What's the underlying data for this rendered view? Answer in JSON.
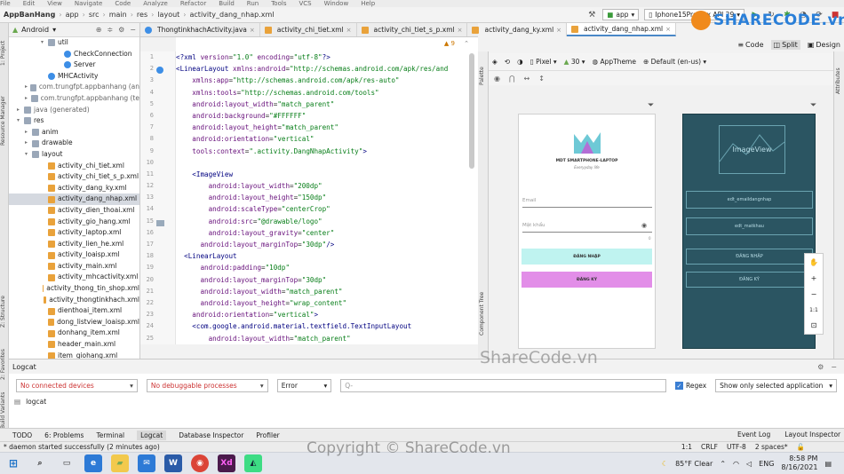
{
  "menu": [
    "File",
    "Edit",
    "View",
    "Navigate",
    "Code",
    "Analyze",
    "Refactor",
    "Build",
    "Run",
    "Tools",
    "VCS",
    "Window",
    "Help"
  ],
  "breadcrumbs": [
    "AppBanHang",
    "app",
    "src",
    "main",
    "res",
    "layout",
    "activity_dang_nhap.xml"
  ],
  "run_config": "app",
  "device": "Iphone15ProMax API 29",
  "project_view": "Android",
  "tree": [
    {
      "label": "util",
      "icon": "folder",
      "indent": 4,
      "arrow": "▾"
    },
    {
      "label": "CheckConnection",
      "icon": "class",
      "indent": 6,
      "arrow": ""
    },
    {
      "label": "Server",
      "icon": "class",
      "indent": 6,
      "arrow": ""
    },
    {
      "label": "MHCActivity",
      "icon": "class",
      "indent": 4,
      "arrow": ""
    },
    {
      "label": "com.trungfpt.appbanhang (an",
      "icon": "folder",
      "indent": 2,
      "arrow": "▸"
    },
    {
      "label": "com.trungfpt.appbanhang (te",
      "icon": "folder",
      "indent": 2,
      "arrow": "▸"
    },
    {
      "label": "java (generated)",
      "icon": "folder",
      "indent": 1,
      "arrow": "▸"
    },
    {
      "label": "res",
      "icon": "folder",
      "indent": 1,
      "arrow": "▾"
    },
    {
      "label": "anim",
      "icon": "folder",
      "indent": 2,
      "arrow": "▸"
    },
    {
      "label": "drawable",
      "icon": "folder",
      "indent": 2,
      "arrow": "▸"
    },
    {
      "label": "layout",
      "icon": "folder",
      "indent": 2,
      "arrow": "▾"
    },
    {
      "label": "activity_chi_tiet.xml",
      "icon": "xml",
      "indent": 4,
      "arrow": ""
    },
    {
      "label": "activity_chi_tiet_s_p.xml",
      "icon": "xml",
      "indent": 4,
      "arrow": ""
    },
    {
      "label": "activity_dang_ky.xml",
      "icon": "xml",
      "indent": 4,
      "arrow": ""
    },
    {
      "label": "activity_dang_nhap.xml",
      "icon": "xml",
      "indent": 4,
      "arrow": "",
      "selected": true
    },
    {
      "label": "activity_dien_thoai.xml",
      "icon": "xml",
      "indent": 4,
      "arrow": ""
    },
    {
      "label": "activity_gio_hang.xml",
      "icon": "xml",
      "indent": 4,
      "arrow": ""
    },
    {
      "label": "activity_laptop.xml",
      "icon": "xml",
      "indent": 4,
      "arrow": ""
    },
    {
      "label": "activity_lien_he.xml",
      "icon": "xml",
      "indent": 4,
      "arrow": ""
    },
    {
      "label": "activity_loaisp.xml",
      "icon": "xml",
      "indent": 4,
      "arrow": ""
    },
    {
      "label": "activity_main.xml",
      "icon": "xml",
      "indent": 4,
      "arrow": ""
    },
    {
      "label": "activity_mhcactivity.xml",
      "icon": "xml",
      "indent": 4,
      "arrow": ""
    },
    {
      "label": "activity_thong_tin_shop.xml",
      "icon": "xml",
      "indent": 4,
      "arrow": ""
    },
    {
      "label": "activity_thongtinkhach.xml",
      "icon": "xml",
      "indent": 4,
      "arrow": ""
    },
    {
      "label": "dienthoai_item.xml",
      "icon": "xml",
      "indent": 4,
      "arrow": ""
    },
    {
      "label": "dong_listview_loaisp.xml",
      "icon": "xml",
      "indent": 4,
      "arrow": ""
    },
    {
      "label": "donhang_item.xml",
      "icon": "xml",
      "indent": 4,
      "arrow": ""
    },
    {
      "label": "header_main.xml",
      "icon": "xml",
      "indent": 4,
      "arrow": ""
    },
    {
      "label": "item_giohang.xml",
      "icon": "xml",
      "indent": 4,
      "arrow": ""
    }
  ],
  "tabs": [
    {
      "label": "ThongtinkhachActivity.java",
      "active": false
    },
    {
      "label": "activity_chi_tiet.xml",
      "active": false
    },
    {
      "label": "activity_chi_tiet_s_p.xml",
      "active": false
    },
    {
      "label": "activity_dang_ky.xml",
      "active": false
    },
    {
      "label": "activity_dang_nhap.xml",
      "active": true
    }
  ],
  "line_numbers": [
    "1",
    "2",
    "3",
    "4",
    "5",
    "6",
    "7",
    "8",
    "9",
    "10",
    "11",
    "12",
    "13",
    "14",
    "15",
    "16",
    "17",
    "18",
    "19",
    "20",
    "21",
    "22",
    "23",
    "24",
    "25"
  ],
  "code_lines": [
    [
      [
        "tg",
        "<?xml "
      ],
      [
        "at",
        "version"
      ],
      [
        "",
        "="
      ],
      [
        "st",
        "\"1.0\""
      ],
      [
        "",
        ""
      ],
      [
        "at",
        " encoding"
      ],
      [
        "",
        "="
      ],
      [
        "st",
        "\"utf-8\""
      ],
      [
        "tg",
        "?>"
      ]
    ],
    [
      [
        "tg",
        "<LinearLayout "
      ],
      [
        "at",
        "xmlns:android"
      ],
      [
        "",
        "="
      ],
      [
        "st",
        "\"http://schemas.android.com/apk/res/and"
      ]
    ],
    [
      [
        "",
        "    "
      ],
      [
        "at",
        "xmlns:app"
      ],
      [
        "",
        "="
      ],
      [
        "st",
        "\"http://schemas.android.com/apk/res-auto\""
      ]
    ],
    [
      [
        "",
        "    "
      ],
      [
        "at",
        "xmlns:tools"
      ],
      [
        "",
        "="
      ],
      [
        "st",
        "\"http://schemas.android.com/tools\""
      ]
    ],
    [
      [
        "",
        "    "
      ],
      [
        "at",
        "android:layout_width"
      ],
      [
        "",
        "="
      ],
      [
        "st",
        "\"match_parent\""
      ]
    ],
    [
      [
        "",
        "    "
      ],
      [
        "at",
        "android:background"
      ],
      [
        "",
        "="
      ],
      [
        "st",
        "\"#FFFFFF\""
      ]
    ],
    [
      [
        "",
        "    "
      ],
      [
        "at",
        "android:layout_height"
      ],
      [
        "",
        "="
      ],
      [
        "st",
        "\"match_parent\""
      ]
    ],
    [
      [
        "",
        "    "
      ],
      [
        "at",
        "android:orientation"
      ],
      [
        "",
        "="
      ],
      [
        "st",
        "\"vertical\""
      ]
    ],
    [
      [
        "",
        "    "
      ],
      [
        "at",
        "tools:context"
      ],
      [
        "",
        "="
      ],
      [
        "st",
        "\".activity.DangNhapActivity\""
      ],
      [
        "tg",
        ">"
      ]
    ],
    [
      [
        "",
        ""
      ]
    ],
    [
      [
        "",
        "    "
      ],
      [
        "tg",
        "<ImageView"
      ]
    ],
    [
      [
        "",
        "        "
      ],
      [
        "at",
        "android:layout_width"
      ],
      [
        "",
        "="
      ],
      [
        "st",
        "\"200dp\""
      ]
    ],
    [
      [
        "",
        "        "
      ],
      [
        "at",
        "android:layout_height"
      ],
      [
        "",
        "="
      ],
      [
        "st",
        "\"150dp\""
      ]
    ],
    [
      [
        "",
        "        "
      ],
      [
        "at",
        "android:scaleType"
      ],
      [
        "",
        "="
      ],
      [
        "st",
        "\"centerCrop\""
      ]
    ],
    [
      [
        "",
        "        "
      ],
      [
        "at",
        "android:src"
      ],
      [
        "",
        "="
      ],
      [
        "st",
        "\"@drawable/logo\""
      ]
    ],
    [
      [
        "",
        "        "
      ],
      [
        "at",
        "android:layout_gravity"
      ],
      [
        "",
        "="
      ],
      [
        "st",
        "\"center\""
      ]
    ],
    [
      [
        "",
        "      "
      ],
      [
        "at",
        "android:layout_marginTop"
      ],
      [
        "",
        "="
      ],
      [
        "st",
        "\"30dp\""
      ],
      [
        "tg",
        "/>"
      ]
    ],
    [
      [
        "",
        "  "
      ],
      [
        "tg",
        "<LinearLayout"
      ]
    ],
    [
      [
        "",
        "      "
      ],
      [
        "at",
        "android:padding"
      ],
      [
        "",
        "="
      ],
      [
        "st",
        "\"10dp\""
      ]
    ],
    [
      [
        "",
        "      "
      ],
      [
        "at",
        "android:layout_marginTop"
      ],
      [
        "",
        "="
      ],
      [
        "st",
        "\"30dp\""
      ]
    ],
    [
      [
        "",
        "      "
      ],
      [
        "at",
        "android:layout_width"
      ],
      [
        "",
        "="
      ],
      [
        "st",
        "\"match_parent\""
      ]
    ],
    [
      [
        "",
        "      "
      ],
      [
        "at",
        "android:layout_height"
      ],
      [
        "",
        "="
      ],
      [
        "st",
        "\"wrap_content\""
      ]
    ],
    [
      [
        "",
        "    "
      ],
      [
        "at",
        "android:orientation"
      ],
      [
        "",
        "="
      ],
      [
        "st",
        "\"vertical\""
      ],
      [
        "tg",
        ">"
      ]
    ],
    [
      [
        "",
        "    "
      ],
      [
        "tg",
        "<com.google.android.material.textfield.TextInputLayout"
      ]
    ],
    [
      [
        "",
        "        "
      ],
      [
        "at",
        "android:layout_width"
      ],
      [
        "",
        "="
      ],
      [
        "st",
        "\"match_parent\""
      ]
    ]
  ],
  "inspection": "9",
  "view_modes": {
    "code": "Code",
    "split": "Split",
    "design": "Design"
  },
  "design_toolbar": {
    "pixel": "Pixel",
    "api": "30",
    "theme": "AppTheme",
    "locale": "Default (en-us)"
  },
  "preview": {
    "logo_title": "MDT SMARTPHONE-LAPTOP",
    "logo_sub": "Everyyday life",
    "email_hint": "Email",
    "password_hint": "Mật khẩu",
    "counter": "0",
    "login_btn": "ĐĂNG NHẬP",
    "register_btn": "ĐĂNG KÝ",
    "login_color": "#bff3f0",
    "register_color": "#e28ee8"
  },
  "blueprint": {
    "image": "ImageView",
    "email": "edt_emaildangnhap",
    "pass": "edt_matkhau",
    "login": "ĐĂNG NHẬP",
    "register": "ĐĂNG KÝ"
  },
  "side_labels": {
    "palette": "Palette",
    "component_tree": "Component Tree",
    "attributes": "Attributes",
    "project": "1: Project",
    "resource_manager": "Resource Manager",
    "structure": "Z: Structure",
    "favorites": "2: Favorites",
    "build_variants": "Build Variants"
  },
  "logcat": {
    "title": "Logcat",
    "device": "No connected devices",
    "process": "No debuggable processes",
    "level": "Error",
    "search_placeholder": "Q-",
    "regex": "Regex",
    "filter": "Show only selected application",
    "tab": "logcat"
  },
  "bottom_tabs": [
    {
      "label": "TODO",
      "on": false
    },
    {
      "label": "6: Problems",
      "on": false
    },
    {
      "label": "Terminal",
      "on": false
    },
    {
      "label": "Logcat",
      "on": true
    },
    {
      "label": "Database Inspector",
      "on": false
    },
    {
      "label": "Profiler",
      "on": false
    }
  ],
  "bottom_right_tabs": [
    "Event Log",
    "Layout Inspector"
  ],
  "status": {
    "message": "* daemon started successfully (2 minutes ago)",
    "pos": "1:1",
    "crlf": "CRLF",
    "enc": "UTF-8",
    "indent": "2 spaces*"
  },
  "taskbar": {
    "weather": "85°F  Clear",
    "lang": "ENG",
    "time": "8:58 PM",
    "date": "8/16/2021"
  },
  "watermark": {
    "logo": "SHARECODE.vn",
    "center": "ShareCode.vn",
    "copyright": "Copyright © ShareCode.vn"
  }
}
